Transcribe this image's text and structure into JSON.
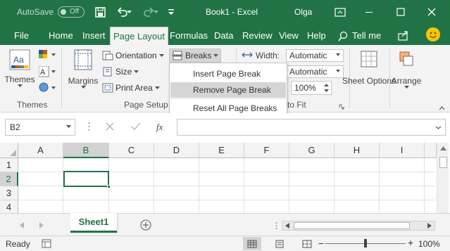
{
  "titlebar": {
    "autosave_label": "AutoSave",
    "autosave_state": "Off",
    "title": "Book1  -  Excel",
    "user": "Olga",
    "icons": [
      "save-icon",
      "undo-icon",
      "redo-icon",
      "customize-qat-icon",
      "ribbon-display-icon",
      "minimize-icon",
      "maximize-icon",
      "close-icon"
    ]
  },
  "tabs": {
    "file": "File",
    "home": "Home",
    "insert": "Insert",
    "page_layout": "Page Layout",
    "formulas": "Formulas",
    "data": "Data",
    "review": "Review",
    "view": "View",
    "help": "Help",
    "tell_me": "Tell me",
    "active": "Page Layout"
  },
  "ribbon": {
    "themes": {
      "button": "Themes",
      "group": "Themes"
    },
    "page_setup": {
      "margins": "Margins",
      "orientation": "Orientation",
      "size": "Size",
      "print_area": "Print Area",
      "breaks": "Breaks",
      "group": "Page Setup"
    },
    "scale_to_fit": {
      "width_label": "Width:",
      "width_value": "Automatic",
      "height_value": "Automatic",
      "scale_value": "100%",
      "group_partial": "to Fit"
    },
    "sheet_options": "Sheet Options",
    "arrange": "Arrange"
  },
  "breaks_menu": {
    "items": [
      "Insert Page Break",
      "Remove Page Break",
      "Reset All Page Breaks"
    ],
    "hovered_index": 1
  },
  "formula_bar": {
    "name_box": "B2",
    "fx": "fx",
    "formula": ""
  },
  "grid": {
    "columns": [
      "A",
      "B",
      "C",
      "D",
      "E",
      "F",
      "G",
      "H",
      "I"
    ],
    "rows": [
      "1",
      "2",
      "3",
      "4"
    ],
    "selected_column": "B",
    "selected_row": "2"
  },
  "sheets": {
    "tabs": [
      "Sheet1"
    ],
    "active": "Sheet1"
  },
  "status": {
    "ready": "Ready",
    "zoom": "100%"
  },
  "colors": {
    "excel_green": "#217346",
    "ribbon_bg": "#f3f3f3",
    "menu_hover": "#d5d5d5"
  }
}
